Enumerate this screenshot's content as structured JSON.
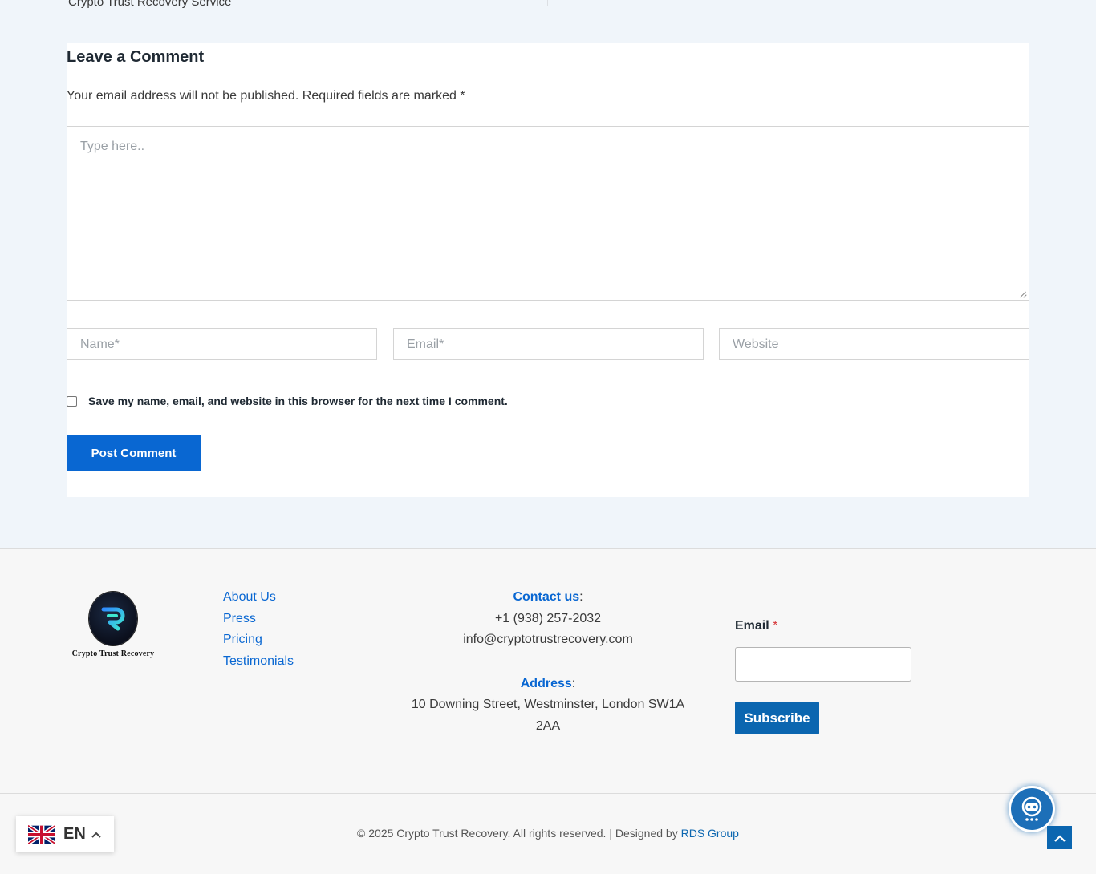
{
  "previous_post": {
    "title": "Crypto Trust Recovery Service"
  },
  "comment_form": {
    "title": "Leave a Comment",
    "notes": "Your email address will not be published. Required fields are marked *",
    "textarea_placeholder": "Type here..",
    "name_placeholder": "Name*",
    "email_placeholder": "Email*",
    "website_placeholder": "Website",
    "cookie_consent_label": "Save my name, email, and website in this browser for the next time I comment.",
    "submit_label": "Post Comment",
    "accent_color": "#0967d2"
  },
  "footer": {
    "logo_text": "Crypto Trust Recovery",
    "links": [
      "About Us",
      "Press",
      "Pricing",
      "Testimonials"
    ],
    "contact": {
      "heading": "Contact us",
      "phone": "+1 (938) 257-2032",
      "email": "info@cryptotrustrecovery.com",
      "address_heading": "Address",
      "address_line1": "10 Downing Street, Westminster, London SW1A",
      "address_line2": "2AA"
    },
    "subscribe": {
      "email_label": "Email",
      "required_mark": "*",
      "button_label": "Subscribe"
    },
    "copyright_text": "© 2025 Crypto Trust Recovery. All rights reserved. | Designed by ",
    "designer_link": "RDS Group"
  },
  "language_switcher": {
    "code": "EN",
    "flag_icon": "uk-flag-icon",
    "chevron_icon": "chevron-up-icon"
  },
  "chat_widget": {
    "icon": "chatbot-icon"
  },
  "scroll_to_top": {
    "icon": "arrow-up-icon"
  }
}
